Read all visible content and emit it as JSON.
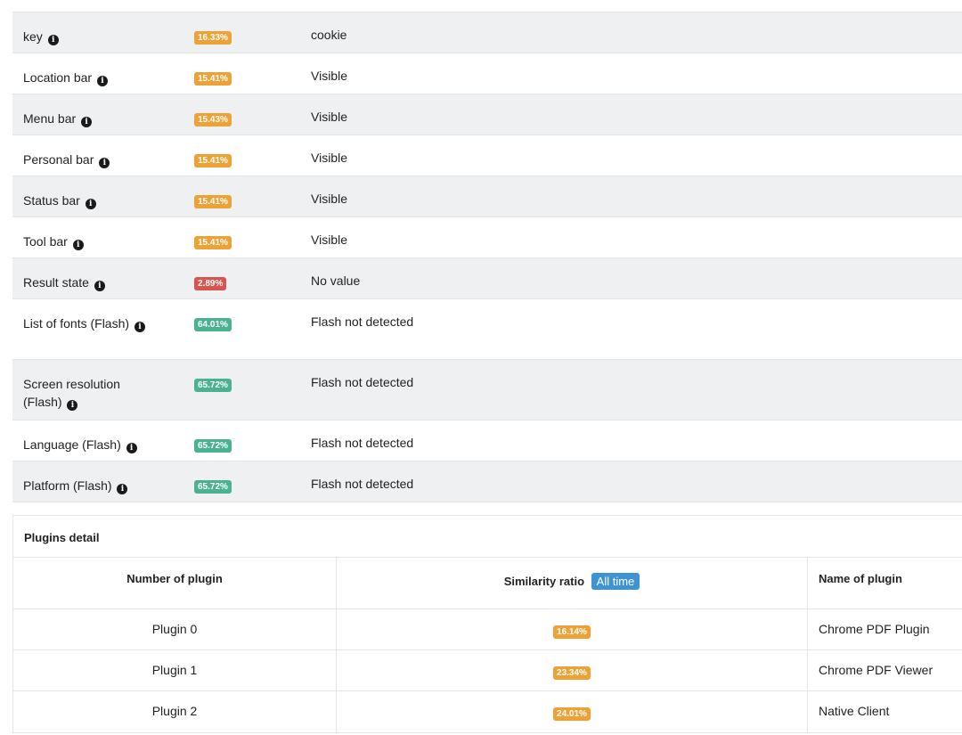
{
  "rows": [
    {
      "name": "key",
      "info": true,
      "ratio": "16.33%",
      "ratio_color": "#eea236",
      "value": "cookie"
    },
    {
      "name": "Location bar",
      "info": true,
      "ratio": "15.41%",
      "ratio_color": "#eea236",
      "value": "Visible"
    },
    {
      "name": "Menu bar",
      "info": true,
      "ratio": "15.43%",
      "ratio_color": "#eea236",
      "value": "Visible"
    },
    {
      "name": "Personal bar",
      "info": true,
      "ratio": "15.41%",
      "ratio_color": "#eea236",
      "value": "Visible"
    },
    {
      "name": "Status bar",
      "info": true,
      "ratio": "15.41%",
      "ratio_color": "#eea236",
      "value": "Visible"
    },
    {
      "name": "Tool bar",
      "info": true,
      "ratio": "15.41%",
      "ratio_color": "#eea236",
      "value": "Visible"
    },
    {
      "name": "Result state",
      "info": true,
      "ratio": "2.89%",
      "ratio_color": "#d9534f",
      "value": "No value"
    },
    {
      "name": "List of fonts (Flash)",
      "info": true,
      "ratio": "64.01%",
      "ratio_color": "#4ab291",
      "value": "Flash not detected"
    },
    {
      "name": "Screen resolution (Flash)",
      "info": true,
      "ratio": "65.72%",
      "ratio_color": "#4ab291",
      "value": "Flash not detected"
    },
    {
      "name": "Language (Flash)",
      "info": true,
      "ratio": "65.72%",
      "ratio_color": "#4ab291",
      "value": "Flash not detected"
    },
    {
      "name": "Platform (Flash)",
      "info": true,
      "ratio": "65.72%",
      "ratio_color": "#4ab291",
      "value": "Flash not detected"
    }
  ],
  "info_icon": "info-icon",
  "plugins": {
    "title": "Plugins detail",
    "headers": {
      "number": "Number of plugin",
      "similarity": "Similarity ratio",
      "all_time": "All time",
      "name": "Name of plugin"
    },
    "rows": [
      {
        "number": "Plugin 0",
        "ratio": "16.14%",
        "name": "Chrome PDF Plugin"
      },
      {
        "number": "Plugin 1",
        "ratio": "23.34%",
        "name": "Chrome PDF Viewer"
      },
      {
        "number": "Plugin 2",
        "ratio": "24.01%",
        "name": "Native Client"
      }
    ]
  }
}
